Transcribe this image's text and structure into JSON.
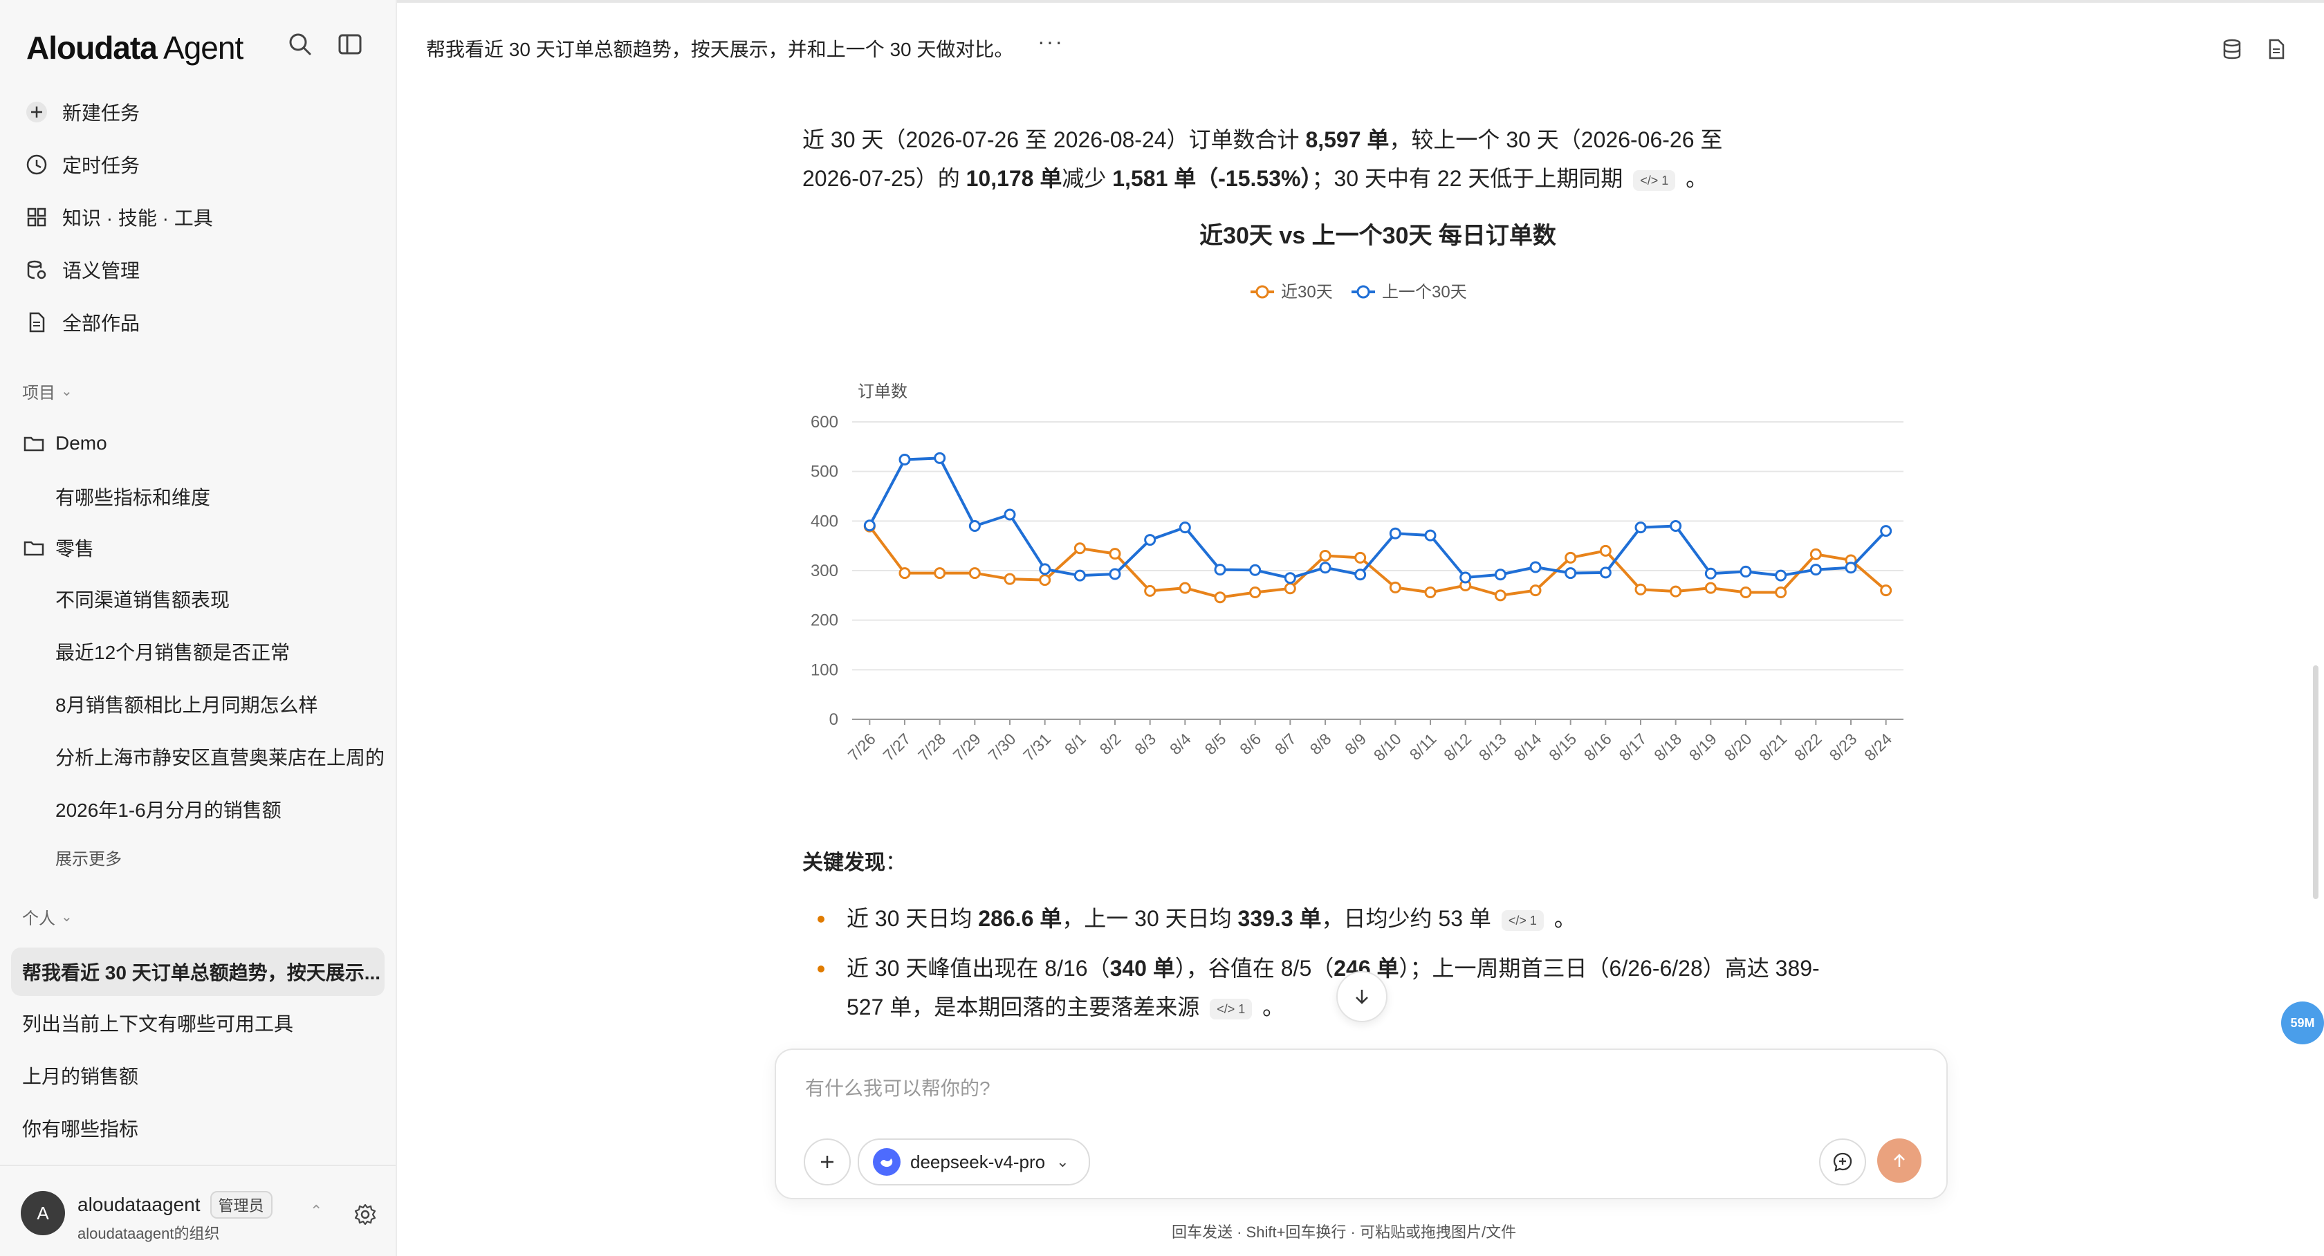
{
  "app": {
    "brand_main": "Aloudata",
    "brand_sub": "Agent"
  },
  "sidebar": {
    "nav": [
      {
        "label": "新建任务",
        "icon": "plus-icon"
      },
      {
        "label": "定时任务",
        "icon": "clock-icon"
      },
      {
        "label": "知识 · 技能 · 工具",
        "icon": "grid-icon"
      },
      {
        "label": "语义管理",
        "icon": "database-gear-icon"
      },
      {
        "label": "全部作品",
        "icon": "document-icon"
      }
    ],
    "projects_label": "项目",
    "projects": [
      {
        "name": "Demo",
        "items": [
          "有哪些指标和维度"
        ]
      },
      {
        "name": "零售",
        "items": [
          "不同渠道销售额表现",
          "最近12个月销售额是否正常",
          "8月销售额相比上月同期怎么样",
          "分析上海市静安区直营奥莱店在上周的",
          "2026年1-6月分月的销售额"
        ]
      }
    ],
    "show_more": "展示更多",
    "personal_label": "个人",
    "chats": [
      {
        "label": "帮我看近 30 天订单总额趋势，按天展示...",
        "active": true
      },
      {
        "label": "列出当前上下文有哪些可用工具",
        "active": false
      },
      {
        "label": "上月的销售额",
        "active": false
      },
      {
        "label": "你有哪些指标",
        "active": false
      }
    ],
    "user": {
      "avatar": "A",
      "name": "aloudataagent",
      "role": "管理员",
      "org": "aloudataagent的组织"
    }
  },
  "header": {
    "title": "帮我看近 30 天订单总额趋势，按天展示，并和上一个 30 天做对比。",
    "more": "···"
  },
  "message": {
    "summary": {
      "p1": "近 30 天（2026-07-26 至 2026-08-24）订单数合计 ",
      "b1": "8,597 单",
      "p2": "，较上一个 30 天（2026-06-26 至 2026-07-25）的 ",
      "b2": "10,178 单",
      "p3": "减少 ",
      "b3": "1,581 单（-15.53%）",
      "p4": "；30 天中有 22 天低于上期同期 ",
      "cite": "</> 1",
      "p5": " 。"
    },
    "findings_title": "关键发现",
    "findings_colon": "：",
    "bullets": [
      {
        "a": "近 30 天日均 ",
        "b1": "286.6 单",
        "c": "，上一 30 天日均 ",
        "b2": "339.3 单",
        "d": "，日均少约 53 单 ",
        "cite": "</> 1",
        "e": " 。"
      },
      {
        "a": "近 30 天峰值出现在 8/16（",
        "b1": "340 单",
        "c": "），谷值在 8/5（",
        "b2": "246 单",
        "d": "）；上一周期首三日（6/26-6/28）高达 389-527 单，是本期回落的主要落差来源 ",
        "cite": "</> 1",
        "e": " 。"
      }
    ]
  },
  "composer": {
    "placeholder": "有什么我可以帮你的?",
    "model": "deepseek-v4-pro",
    "hint": "回车发送 · Shift+回车换行 · 可粘贴或拖拽图片/文件"
  },
  "memory_badge": "59M",
  "colors": {
    "current": "#e8831a",
    "previous": "#1f6fd6",
    "accent_send": "#eaa27e"
  },
  "chart_data": {
    "type": "line",
    "title": "近30天 vs 上一个30天 每日订单数",
    "ylabel": "订单数",
    "xlabel": "",
    "ylim": [
      0,
      600
    ],
    "yticks": [
      0,
      100,
      200,
      300,
      400,
      500,
      600
    ],
    "legend_position": "top-center",
    "grid": true,
    "categories": [
      "7/26",
      "7/27",
      "7/28",
      "7/29",
      "7/30",
      "7/31",
      "8/1",
      "8/2",
      "8/3",
      "8/4",
      "8/5",
      "8/6",
      "8/7",
      "8/8",
      "8/9",
      "8/10",
      "8/11",
      "8/12",
      "8/13",
      "8/14",
      "8/15",
      "8/16",
      "8/17",
      "8/18",
      "8/19",
      "8/20",
      "8/21",
      "8/22",
      "8/23",
      "8/24"
    ],
    "series": [
      {
        "name": "近30天",
        "color": "#e8831a",
        "values": [
          389,
          295,
          295,
          295,
          283,
          281,
          345,
          334,
          259,
          265,
          246,
          256,
          264,
          330,
          326,
          266,
          256,
          270,
          250,
          260,
          326,
          340,
          262,
          258,
          265,
          256,
          256,
          333,
          321,
          260
        ]
      },
      {
        "name": "上一个30天",
        "color": "#1f6fd6",
        "values": [
          391,
          524,
          527,
          390,
          413,
          303,
          290,
          293,
          362,
          387,
          302,
          301,
          285,
          306,
          292,
          375,
          371,
          286,
          292,
          307,
          295,
          296,
          387,
          390,
          294,
          298,
          290,
          302,
          306,
          380
        ]
      }
    ]
  }
}
